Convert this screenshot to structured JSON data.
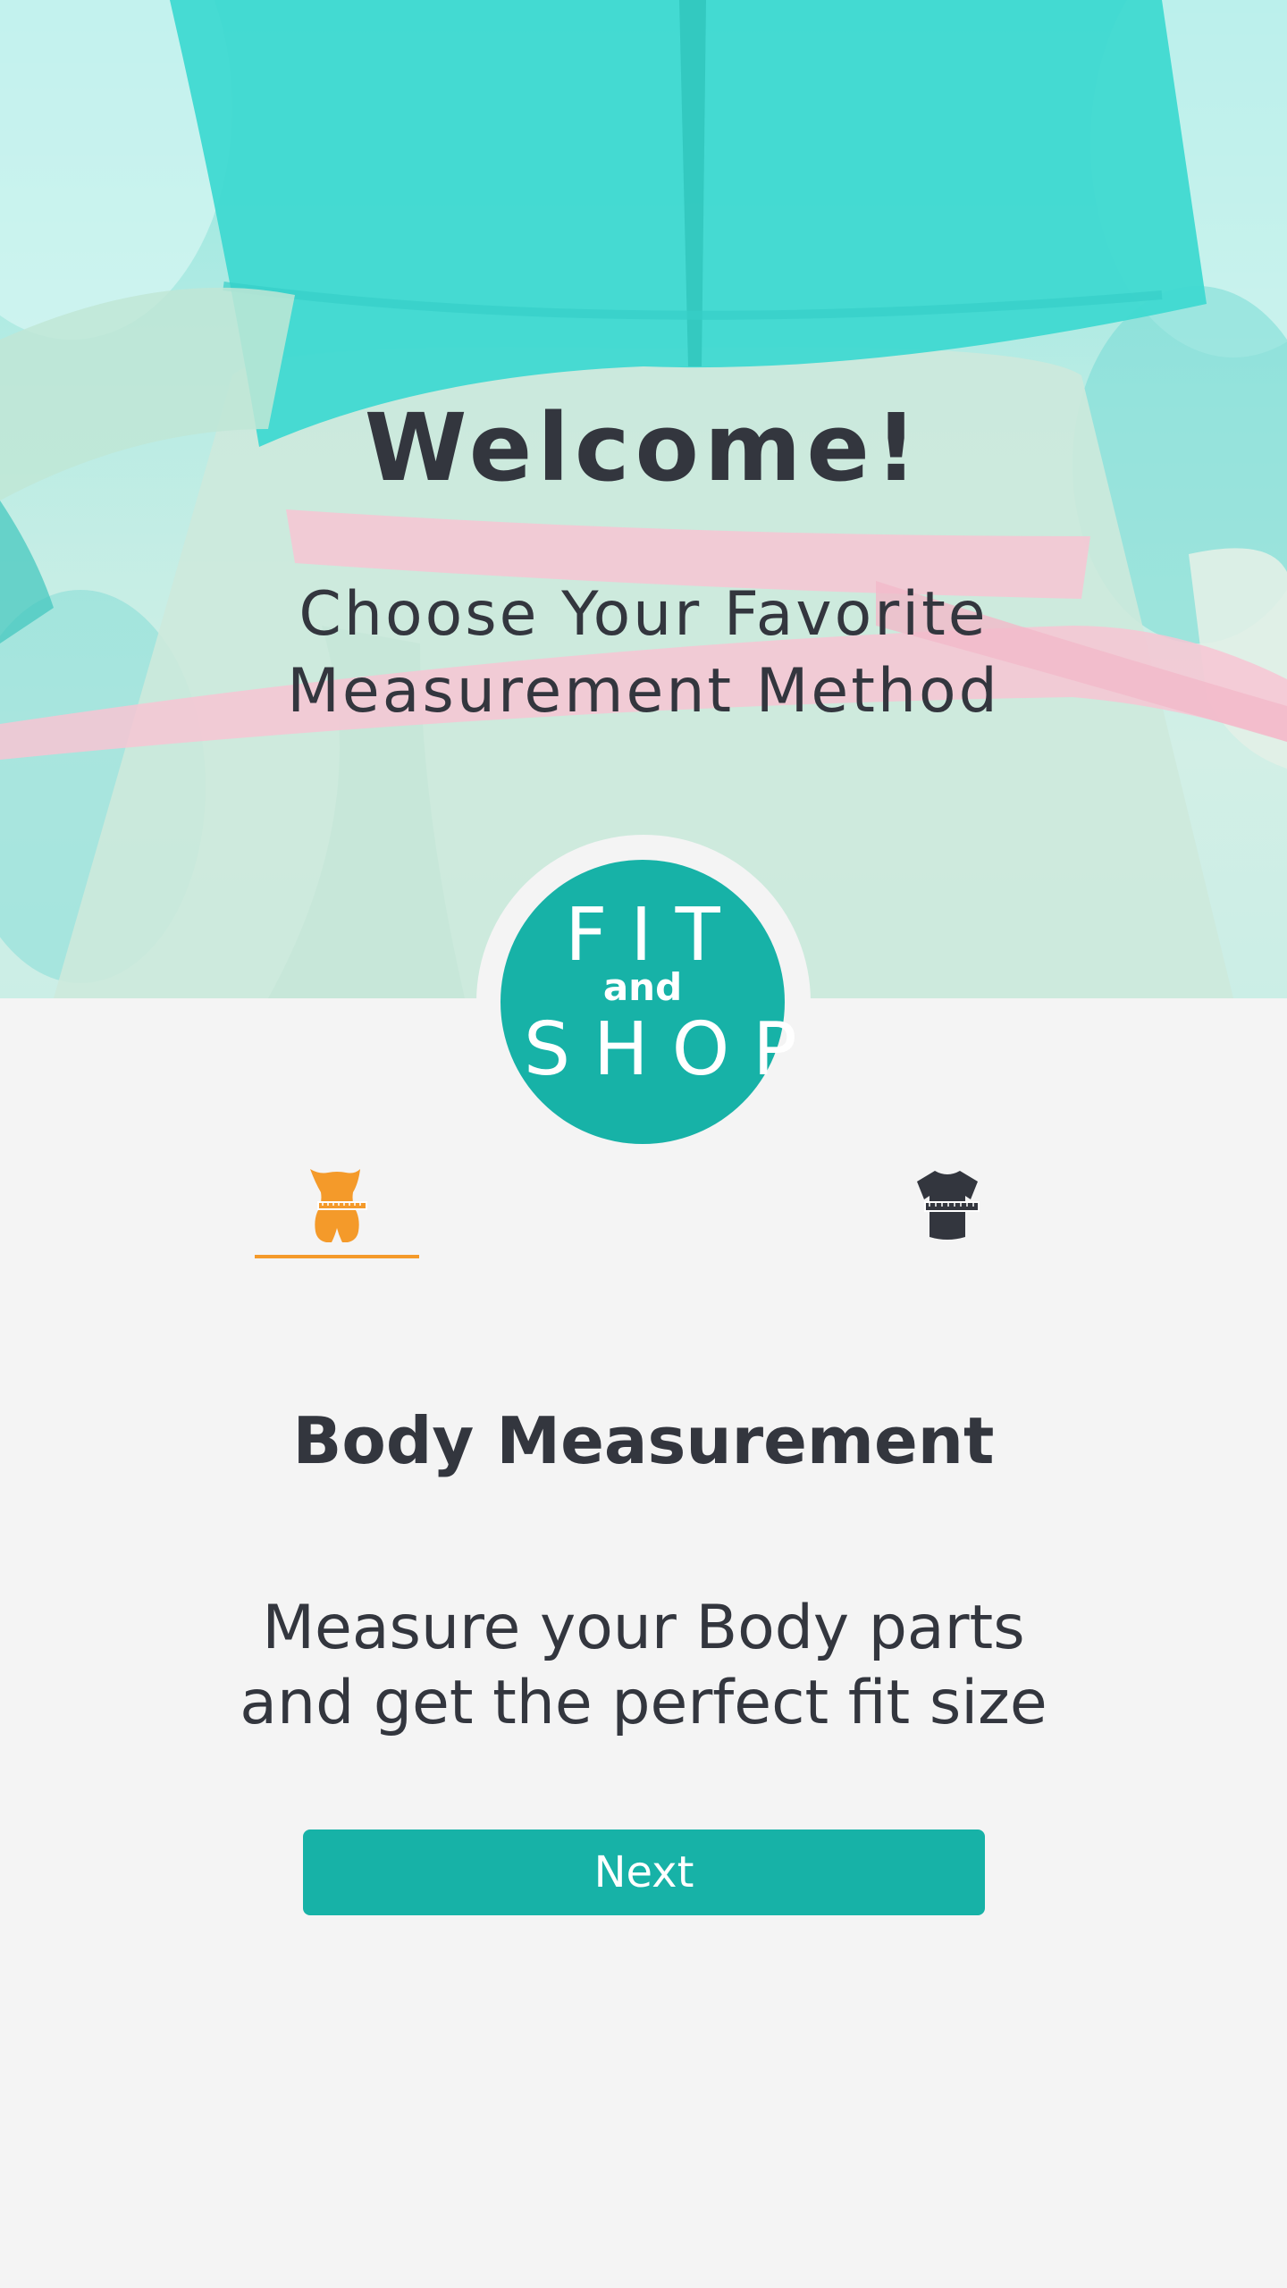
{
  "hero": {
    "title": "Welcome!",
    "subtitle_line1": "Choose Your Favorite",
    "subtitle_line2": "Measurement Method"
  },
  "logo": {
    "line1": "FIT",
    "line2": "and",
    "line3": "SHOP"
  },
  "tabs": [
    {
      "id": "body",
      "icon": "body-measure-icon",
      "active": true,
      "color": "#f49a2a"
    },
    {
      "id": "clothes",
      "icon": "tshirt-measure-icon",
      "active": false,
      "color": "#33363e"
    }
  ],
  "content": {
    "title": "Body Measurement",
    "desc_line1": "Measure your Body parts",
    "desc_line2": "and get the perfect fit size"
  },
  "next_button": {
    "label": "Next"
  },
  "colors": {
    "accent_teal": "#17b2a7",
    "accent_orange": "#f49a2a",
    "text_dark": "#33363e",
    "background": "#f4f4f4"
  }
}
